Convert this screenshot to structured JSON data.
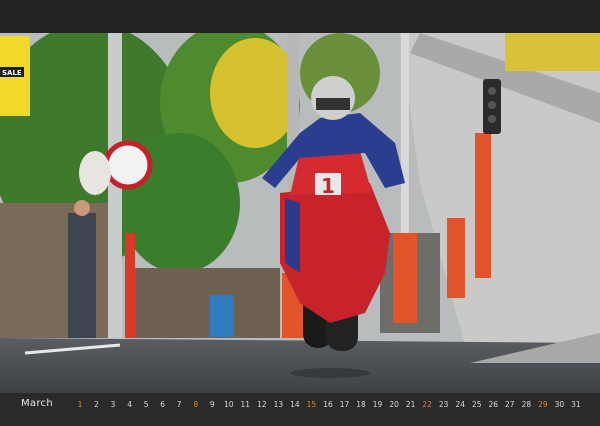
{
  "calendar": {
    "month": "March",
    "days": [
      {
        "n": "1",
        "sunday": true
      },
      {
        "n": "2"
      },
      {
        "n": "3"
      },
      {
        "n": "4"
      },
      {
        "n": "5"
      },
      {
        "n": "6"
      },
      {
        "n": "7"
      },
      {
        "n": "8",
        "sunday": true
      },
      {
        "n": "9"
      },
      {
        "n": "10"
      },
      {
        "n": "11"
      },
      {
        "n": "12"
      },
      {
        "n": "13"
      },
      {
        "n": "14"
      },
      {
        "n": "15",
        "sunday": true
      },
      {
        "n": "16"
      },
      {
        "n": "17"
      },
      {
        "n": "18"
      },
      {
        "n": "19"
      },
      {
        "n": "20"
      },
      {
        "n": "21"
      },
      {
        "n": "22",
        "sunday": true
      },
      {
        "n": "23"
      },
      {
        "n": "24"
      },
      {
        "n": "25"
      },
      {
        "n": "26"
      },
      {
        "n": "27"
      },
      {
        "n": "28"
      },
      {
        "n": "29",
        "sunday": true
      },
      {
        "n": "30"
      },
      {
        "n": "31"
      }
    ],
    "sunday_color": "#d98a2b"
  },
  "photo": {
    "sign_text": "SALE",
    "race_number": "1"
  }
}
